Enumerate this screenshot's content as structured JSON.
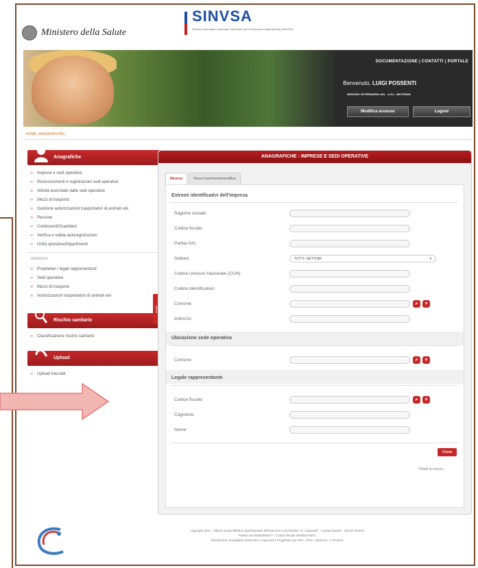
{
  "header": {
    "ministry": "Ministero della Salute",
    "app_title": "SINVSA",
    "app_subtitle": "Sistema Informativo Nazionale Veterinario per la Sicurezza degli Alimenti (SINVSA)"
  },
  "banner": {
    "topnav": "DOCUMENTAZIONE | CONTATTI | PORTALE",
    "welcome_prefix": "Benvenuto,",
    "user_name": "LUIGI POSSENTI",
    "service": "SERVIZIO VETERINARIO ASL - A.S.L. 000TERAM",
    "modify_button": "Modifica accesso",
    "logout_button": "Logout"
  },
  "breadcrumb": "HOME | ANAGRAFICHE |",
  "sidebar": {
    "anagrafiche_title": "Anagrafiche",
    "items": [
      "Imprese e sedi operative",
      "Riconoscimenti e registrazioni sedi operative",
      "Attività esercitate dalle sedi operative",
      "Mezzi di trasporto",
      "Gestione autorizzazioni trasportatori di animali vivi",
      "Persone",
      "Conducenti/Guardiani",
      "Verifica e valida autoregistrazioni",
      "Unità operative/Dipartimenti"
    ],
    "variazioni_label": "Variazioni",
    "variazioni_items": [
      "Proprietari / legali rappresentanti",
      "Sedi operative",
      "Mezzi di trasporto",
      "Autorizzazioni trasportatori di animali vivi"
    ],
    "rischio_title": "Rischio sanitario",
    "rischio_items": [
      "Classificazione rischio sanitario"
    ],
    "upload_title": "Upload",
    "upload_items": [
      "Upload tracciati"
    ],
    "collapse_tab": "chiudi"
  },
  "panel": {
    "title": "ANAGRAFICHE - IMPRESE E SEDI OPERATIVE",
    "tabs": [
      "Ricerca",
      "Nuovo inserimento/modifica"
    ],
    "section1": "Estremi identificativi dell'impresa",
    "fields1": [
      "Ragione sociale:",
      "Codice fiscale:",
      "Partita IVA:",
      "Settore:",
      "Codice Univoco Nazionale (CUN):",
      "Codice identificativo:",
      "Comune:",
      "Indirizzo:"
    ],
    "settore_value": "TUTTI i SETTORI",
    "section2": "Ubicazione sede operativa",
    "fields2": [
      "Comune:"
    ],
    "section3": "Legale rappresentante",
    "fields3": [
      "Codice fiscale:",
      "Cognome:",
      "Nome:"
    ],
    "search_button": "Cerca",
    "close_search": "Chiudi la ricerca"
  },
  "footer": {
    "line1": "Copyright 2011 - Istituto Zooprofilattico Sperimentale dell'Abruzzo e del Molise \"G. Caporale\" - Campo Boario - 64100 Teramo",
    "line2": "Partita Iva 00083550677 - Codice fiscale 80006470670",
    "line3": "Risoluzione consigliata 1024x768 o superiore | Progettato per IE9+, FF4+, Opera 9+ e Chrome"
  },
  "colors": {
    "primary_red": "#c62828",
    "frame_brown": "#7a4a2a",
    "arrow_fill": "#f2b6b3"
  }
}
